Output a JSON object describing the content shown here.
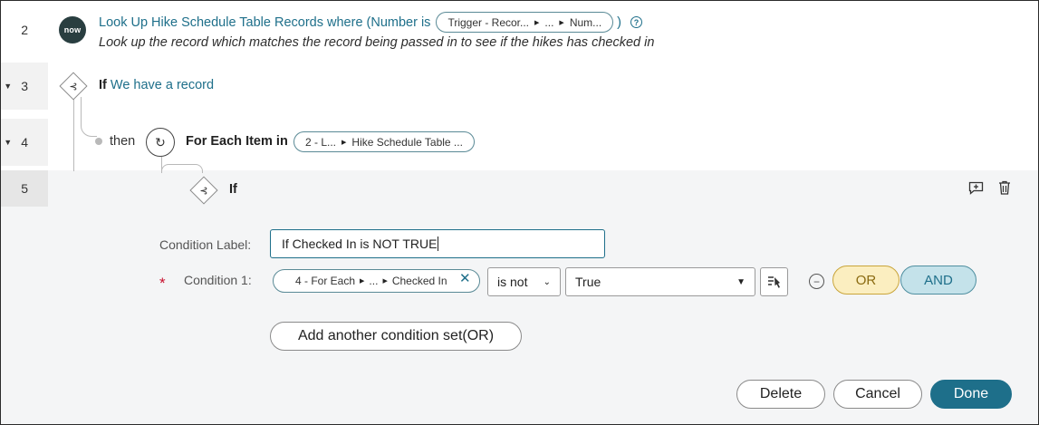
{
  "steps": {
    "step2": {
      "number": "2",
      "badge": "now",
      "title": "Look Up Hike Schedule Table Records where (Number is",
      "pill": {
        "part1": "Trigger - Recor...",
        "part2": "...",
        "part3": "Num..."
      },
      "close_paren": ")",
      "help_icon": "?",
      "description": "Look up the record which matches the record being passed in to see if the hikes has checked in"
    },
    "step3": {
      "number": "3",
      "keyword": "If",
      "label": "We have a record"
    },
    "step4": {
      "number": "4",
      "then": "then",
      "keyword": "For Each Item in",
      "pill": {
        "part1": "2 - L...",
        "part2": "Hike Schedule Table ..."
      }
    },
    "step5": {
      "number": "5",
      "keyword": "If"
    }
  },
  "icons": {
    "branch": "⊰",
    "loop": "↻",
    "add_comment": "comment-add-icon",
    "trash": "trash-icon",
    "data_pill_picker": "data-pill-picker-icon",
    "remove": "−",
    "caret": "▼"
  },
  "form": {
    "condition_label_caption": "Condition Label:",
    "condition_label_value": "If Checked In is NOT TRUE",
    "required_marker": "*",
    "condition1_caption": "Condition 1:",
    "condition1_pill": {
      "part1": "4 - For Each",
      "part2": "...",
      "part3": "Checked In"
    },
    "condition1_remove": "✕",
    "operator": "is not",
    "value": "True",
    "or_label": "OR",
    "and_label": "AND",
    "add_condition_set": "Add another condition set(OR)"
  },
  "footer": {
    "delete": "Delete",
    "cancel": "Cancel",
    "done": "Done"
  },
  "colors": {
    "accent": "#1e6f8a",
    "or_bg": "#fbeec0",
    "and_bg": "#c4e2ea",
    "required": "#c8102e"
  }
}
